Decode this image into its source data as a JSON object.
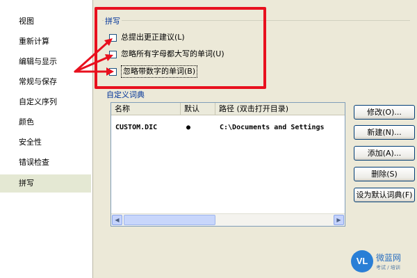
{
  "sidebar": {
    "items": [
      {
        "label": "视图"
      },
      {
        "label": "重新计算"
      },
      {
        "label": "编辑与显示"
      },
      {
        "label": "常规与保存"
      },
      {
        "label": "自定义序列"
      },
      {
        "label": "颜色"
      },
      {
        "label": "安全性"
      },
      {
        "label": "错误检查"
      },
      {
        "label": "拼写",
        "selected": true
      }
    ]
  },
  "spelling": {
    "group_title": "拼写",
    "options": [
      {
        "label": "总提出更正建议(L)",
        "checked": false
      },
      {
        "label": "忽略所有字母都大写的单词(U)",
        "checked": false
      },
      {
        "label": "忽略带数字的单词(B)",
        "checked": false,
        "focused": true
      }
    ]
  },
  "dictionary": {
    "group_title": "自定义词典",
    "columns": [
      "名称",
      "默认",
      "路径 (双击打开目录)"
    ],
    "rows": [
      {
        "name": "CUSTOM.DIC",
        "default": "●",
        "path": "C:\\Documents and Settings"
      }
    ],
    "buttons": [
      "修改(O)...",
      "新建(N)...",
      "添加(A)...",
      "删除(S)",
      "设为默认词典(F)"
    ]
  },
  "watermark": {
    "logo_text": "VL",
    "name": "微蓝网",
    "subtitle": "考试 / 培训"
  },
  "colors": {
    "highlight": "#e8101e",
    "selected_row": "#e4e8d3",
    "group_title": "#003399"
  }
}
